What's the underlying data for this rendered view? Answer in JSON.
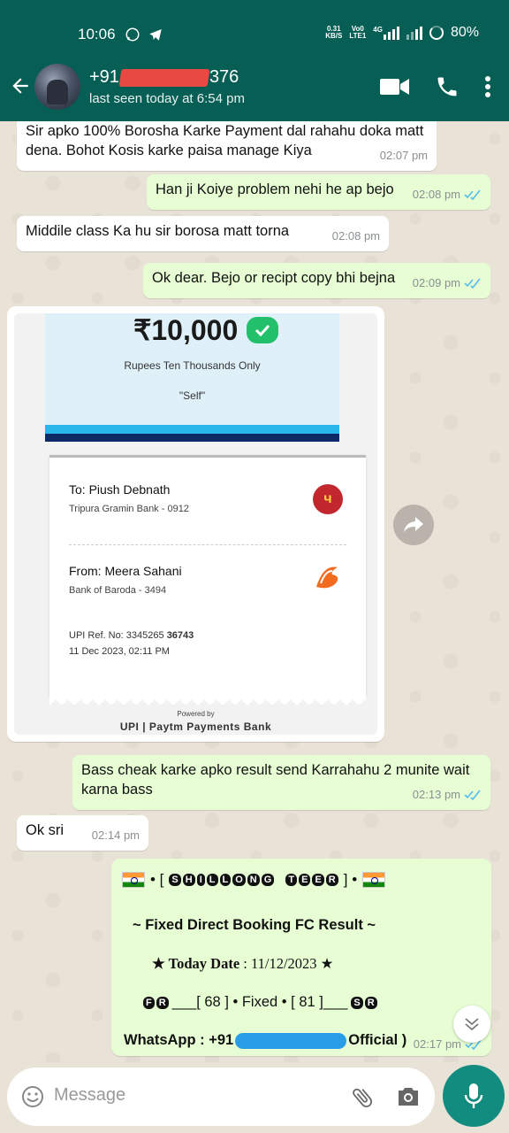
{
  "status_bar": {
    "time": "10:06",
    "net_speed_value": "0.31",
    "net_speed_unit": "KB/S",
    "volte_top": "Vo0",
    "volte_bottom": "LTE1",
    "signal_label": "4G",
    "battery": "80%"
  },
  "contact": {
    "number_prefix": "+91",
    "number_suffix": "376",
    "last_seen": "last seen today at 6:54 pm"
  },
  "messages": [
    {
      "direction": "in",
      "text": "Sir apko 100% Borosha Karke Payment dal rahahu doka matt dena. Bohot Kosis karke paisa manage Kiya",
      "time": "02:07 pm"
    },
    {
      "direction": "out",
      "text": "Han ji Koiye problem nehi he ap bejo",
      "time": "02:08 pm"
    },
    {
      "direction": "in",
      "text": "Middile class Ka hu sir borosa matt torna",
      "time": "02:08 pm"
    },
    {
      "direction": "out",
      "text": "Ok dear. Bejo or recipt copy bhi bejna",
      "time": "02:09 pm"
    },
    {
      "direction": "out",
      "text": "Bass cheak karke apko result send Karrahahu 2 munite wait karna bass",
      "time": "02:13 pm"
    },
    {
      "direction": "in",
      "text": "Ok sri",
      "time": "02:14 pm"
    }
  ],
  "receipt": {
    "amount": "₹10,000",
    "amount_words": "Rupees Ten Thousands Only",
    "note": "\"Self\"",
    "to_name": "To: Piush Debnath",
    "to_bank": "Tripura Gramin Bank - 0912",
    "from_name": "From: Meera Sahani",
    "from_bank": "Bank of Baroda - 3494",
    "upi_ref_label": "UPI Ref. No: 3345265",
    "upi_ref_bold": "36743",
    "datetime": "11 Dec 2023, 02:11 PM",
    "powered_by": "Powered by",
    "brand": "UPI | Paytm Payments Bank"
  },
  "teer_message": {
    "title_letters": [
      "S",
      "H",
      "I",
      "L",
      "L",
      "O",
      "N",
      "G",
      " ",
      "T",
      "E",
      "E",
      "R"
    ],
    "bracket_open": "• [",
    "bracket_close": "] •",
    "line2": "~ Fixed Direct Booking FC Result ~",
    "line3_label": "★ Today Date",
    "line3_value": ": 11/12/2023 ★",
    "fr_letters": [
      "F",
      "R"
    ],
    "sr_letters": [
      "S",
      "R"
    ],
    "fr_value": "___[ 68 ] • Fixed • [ 81 ]___",
    "line5_prefix": "WhatsApp : +91",
    "line5_suffix": "Official )",
    "time": "02:17 pm"
  },
  "input": {
    "placeholder": "Message"
  },
  "colors": {
    "header": "#075e54",
    "outgoing_bubble": "#e7fdd3",
    "incoming_bubble": "#ffffff",
    "mic_button": "#128c7e",
    "read_ticks": "#53bdeb"
  }
}
